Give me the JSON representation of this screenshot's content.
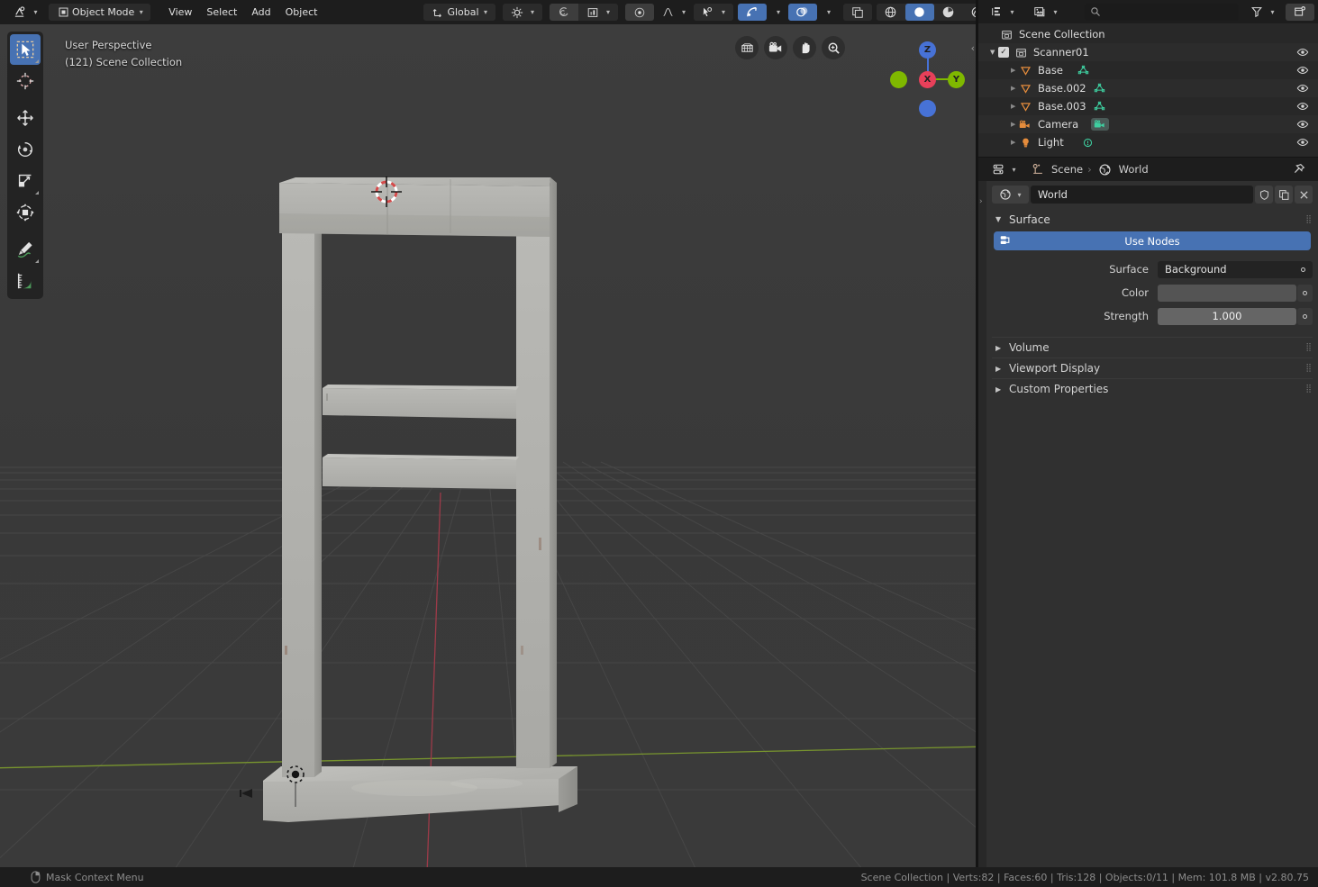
{
  "topbar": {
    "editor_type_icon": "editor-type-icon",
    "mode": "Object Mode",
    "menus": [
      "View",
      "Select",
      "Add",
      "Object"
    ],
    "transform_orientation": "Global",
    "snap_icon": "magnet-icon",
    "proportional_icon": "proportional-editing-icon",
    "overlay_icon": "overlays-icon",
    "xray_icon": "xray-icon",
    "gizmo_icon": "gizmo-icon",
    "shading_modes": [
      "wireframe",
      "solid",
      "material-preview",
      "rendered"
    ],
    "active_shading": "solid"
  },
  "viewport": {
    "perspective": "User Perspective",
    "collection_info": "(121) Scene Collection",
    "tools": [
      {
        "name": "tweak-select-box-tool",
        "label": "Select Box",
        "active": true
      },
      {
        "name": "cursor-tool",
        "label": "Cursor",
        "active": false
      },
      {
        "name": "move-tool",
        "label": "Move",
        "active": false
      },
      {
        "name": "rotate-tool",
        "label": "Rotate",
        "active": false
      },
      {
        "name": "scale-tool",
        "label": "Scale",
        "active": false
      },
      {
        "name": "transform-tool",
        "label": "Transform",
        "active": false
      },
      {
        "name": "annotate-tool",
        "label": "Annotate",
        "active": false
      },
      {
        "name": "measure-tool",
        "label": "Measure",
        "active": false
      }
    ],
    "nav_buttons": [
      "toggle-camera-perspective",
      "camera-view",
      "move-view",
      "zoom-view"
    ],
    "gizmo_axes": [
      {
        "label": "Z",
        "color": "#4772d6"
      },
      {
        "label": "X",
        "color": "#e8405a"
      },
      {
        "label": "Y",
        "color": "#7fb800"
      }
    ],
    "colors": {
      "background": "#3c3c3c",
      "grid": "#4a4a4a",
      "x_axis": "#a33b4a",
      "y_axis": "#7c9a2e",
      "model_light": "#b4b4b0",
      "model_mid": "#a0a09c",
      "model_dark": "#8d8d8a"
    }
  },
  "outliner": {
    "display_mode_icon": "outliner-display-mode-icon",
    "filter_id_icon": "filter-id-icon",
    "search_placeholder": "",
    "filter_icon": "filter-funnel-icon",
    "new_collection_icon": "new-collection-icon",
    "root": "Scene Collection",
    "items": [
      {
        "label": "Scanner01",
        "icon": "collection-icon",
        "indent": 1,
        "expanded": true,
        "checkbox": true,
        "type": "collection"
      },
      {
        "label": "Base",
        "icon": "mesh-object-icon",
        "indent": 2,
        "type": "mesh",
        "data_icon": "mesh-data-icon"
      },
      {
        "label": "Base.002",
        "icon": "mesh-object-icon",
        "indent": 2,
        "type": "mesh",
        "data_icon": "mesh-data-icon"
      },
      {
        "label": "Base.003",
        "icon": "mesh-object-icon",
        "indent": 2,
        "type": "mesh",
        "data_icon": "mesh-data-icon"
      },
      {
        "label": "Camera",
        "icon": "camera-object-icon",
        "indent": 2,
        "type": "camera",
        "data_icon": "camera-data-icon"
      },
      {
        "label": "Light",
        "icon": "light-object-icon",
        "indent": 2,
        "type": "light",
        "data_icon": "light-data-icon"
      }
    ]
  },
  "properties": {
    "editor_icon": "properties-editor-icon",
    "breadcrumb_scene": "Scene",
    "breadcrumb_world": "World",
    "pin_icon": "pin-icon",
    "id_icon": "world-icon",
    "id_name": "World",
    "id_buttons": [
      "fake-user-shield-icon",
      "duplicate-icon",
      "unlink-x-icon"
    ],
    "panels": [
      {
        "name": "Surface",
        "open": true
      },
      {
        "name": "Volume",
        "open": false
      },
      {
        "name": "Viewport Display",
        "open": false
      },
      {
        "name": "Custom Properties",
        "open": false
      }
    ],
    "use_nodes_label": "Use Nodes",
    "fields": [
      {
        "label": "Surface",
        "value": "Background",
        "kind": "dropdown"
      },
      {
        "label": "Color",
        "value": "",
        "kind": "swatch"
      },
      {
        "label": "Strength",
        "value": "1.000",
        "kind": "slider"
      }
    ],
    "accent": "#4772b3"
  },
  "status": {
    "left_icon": "mouse-right-button-icon",
    "left_text": "Mask Context Menu",
    "right_text": "Scene Collection | Verts:82 | Faces:60 | Tris:128 | Objects:0/11 | Mem: 101.8 MB | v2.80.75"
  }
}
